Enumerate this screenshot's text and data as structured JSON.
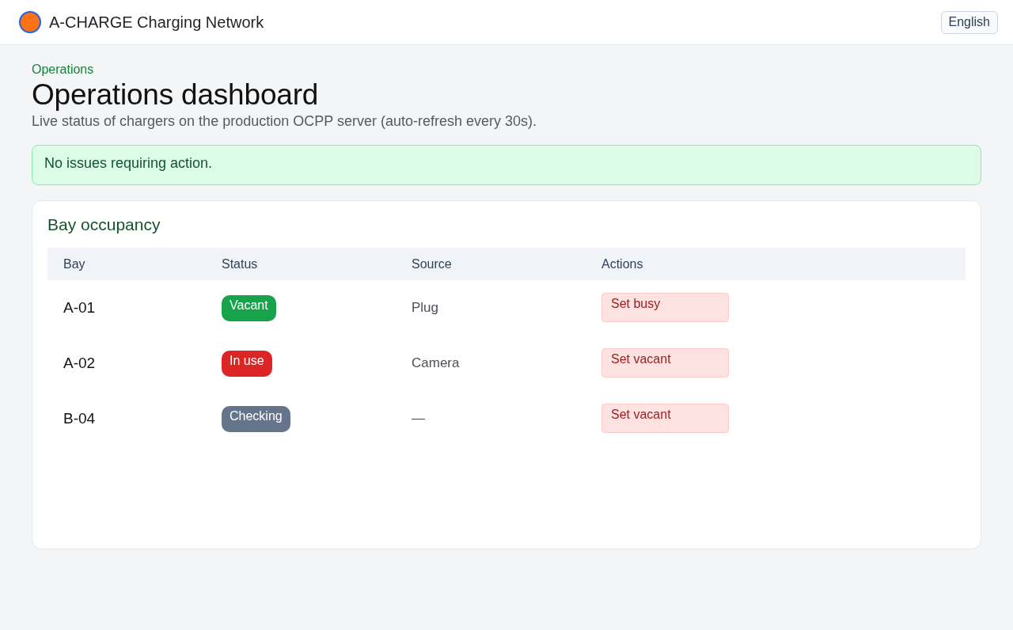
{
  "header": {
    "title": "A-CHARGE Charging Network",
    "language_button": "English"
  },
  "page": {
    "breadcrumb": "Operations",
    "title": "Operations dashboard",
    "subtitle": "Live status of chargers on the production OCPP server (auto-refresh every 30s)."
  },
  "alert": {
    "kind": "success",
    "text": "No issues requiring action."
  },
  "bay_occupancy": {
    "title": "Bay occupancy",
    "columns": [
      "Bay",
      "Status",
      "Source",
      "Actions"
    ],
    "rows": [
      {
        "bay": "A-01",
        "status": {
          "label": "Vacant",
          "color": "#16a34a"
        },
        "source": "Plug",
        "action": "Set busy"
      },
      {
        "bay": "A-02",
        "status": {
          "label": "In use",
          "color": "#dc2626"
        },
        "source": "Camera",
        "action": "Set vacant"
      },
      {
        "bay": "B-04",
        "status": {
          "label": "Checking",
          "color": "#64748b"
        },
        "source": "—",
        "action": "Set vacant"
      }
    ]
  }
}
